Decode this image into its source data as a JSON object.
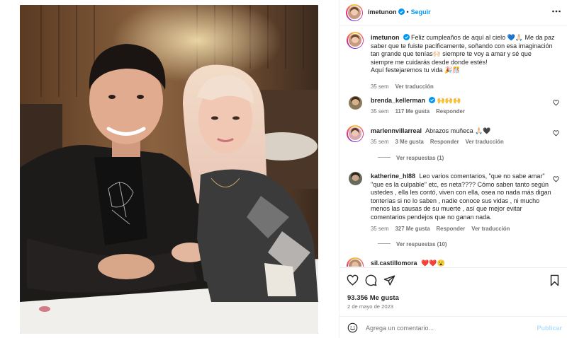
{
  "post": {
    "username": "imetunon",
    "follow_label": "Seguir",
    "separator": "•",
    "more_icon": "more-horizontal-icon"
  },
  "caption": {
    "username": "imetunon",
    "text": "Feliz cumpleaños de aquí al cielo 💙🙏🏻 Me da paz saber que te fuiste pacíficamente, soñando con esa imaginación tan grande que tenías🙌🏻 siempre te voy a amar y sé que siempre me cuidarás desde donde estés!",
    "text2": "Aquí festejaremos tu vida 🎉🎊",
    "time": "35 sem",
    "translate": "Ver traducción"
  },
  "comments": [
    {
      "username": "brenda_kellerman",
      "verified": true,
      "text": "🙌🙌🙌",
      "time": "35 sem",
      "likes": "117 Me gusta",
      "reply": "Responder"
    },
    {
      "username": "marlennvillarreal",
      "verified": false,
      "text": "Abrazos muñeca 🙏🏻🖤",
      "time": "35 sem",
      "likes": "3 Me gusta",
      "reply": "Responder",
      "translate": "Ver traducción",
      "replies": "Ver respuestas (1)"
    },
    {
      "username": "katherine_hl88",
      "verified": false,
      "text": "Leo varios comentarios, \"que no sabe amar\" \"que es la culpable\" etc, es neta???? Cómo saben tanto según ustedes , ella les contó, viven con ella, osea no nada más digan tonterías si no lo saben , nadie conoce sus vidas , ni mucho menos las causas de su muerte , así que mejor evitar comentarios pendejos que no ganan nada.",
      "time": "35 sem",
      "likes": "327 Me gusta",
      "reply": "Responder",
      "translate": "Ver traducción",
      "replies": "Ver respuestas (10)"
    },
    {
      "username": "sil.castillomora",
      "verified": false,
      "text": "❤️❤️😮"
    }
  ],
  "stats": {
    "likes": "93.356 Me gusta",
    "date": "2 de mayo de 2023"
  },
  "composer": {
    "placeholder": "Agrega un comentario...",
    "post_label": "Publicar"
  },
  "colors": {
    "accent": "#0095f6",
    "verified": "#0095f6",
    "muted": "#737373",
    "border": "#efefef"
  }
}
